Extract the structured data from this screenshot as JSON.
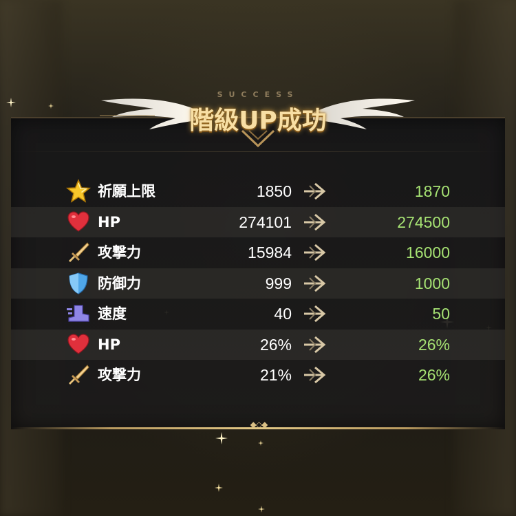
{
  "header": {
    "subtitle": "SUCCESS",
    "title": "階級UP成功"
  },
  "stats": [
    {
      "icon": "star-icon",
      "label": "祈願上限",
      "old": "1850",
      "new": "1870"
    },
    {
      "icon": "heart-icon",
      "label": "HP",
      "old": "274101",
      "new": "274500"
    },
    {
      "icon": "sword-icon",
      "label": "攻撃力",
      "old": "15984",
      "new": "16000"
    },
    {
      "icon": "shield-icon",
      "label": "防御力",
      "old": "999",
      "new": "1000"
    },
    {
      "icon": "boot-icon",
      "label": "速度",
      "old": "40",
      "new": "50"
    },
    {
      "icon": "heart-icon",
      "label": "HP",
      "old": "26%",
      "new": "26%"
    },
    {
      "icon": "sword-icon",
      "label": "攻撃力",
      "old": "21%",
      "new": "26%"
    }
  ],
  "colors": {
    "new_value": "#a6e273",
    "title_gold": "#f8dfa4"
  }
}
